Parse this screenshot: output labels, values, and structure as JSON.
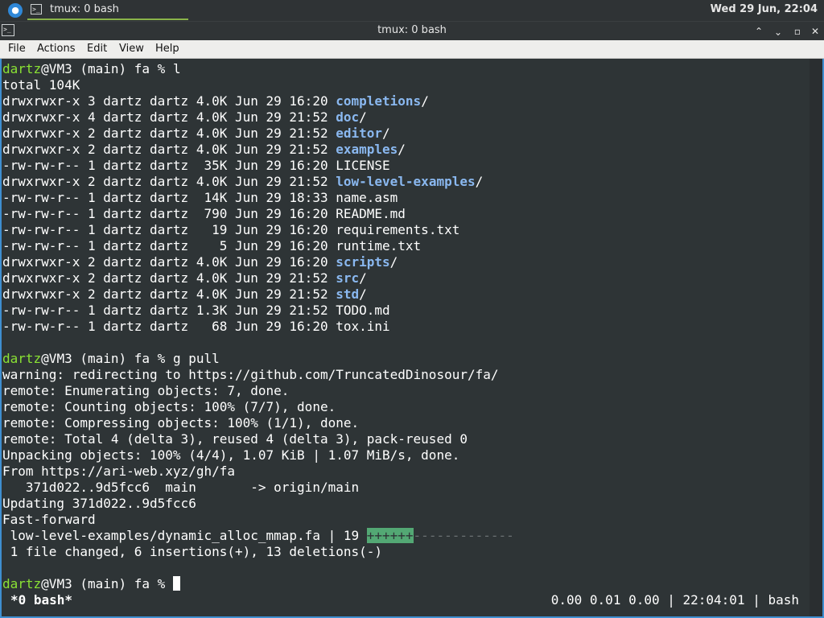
{
  "panel": {
    "task_label": "tmux: 0 bash",
    "clock": "Wed 29 Jun, 22:04"
  },
  "window": {
    "title": "tmux: 0 bash",
    "minimize": "⌃",
    "maximize": "⌃",
    "restore": "▫",
    "close": "✕"
  },
  "menu": [
    "File",
    "Actions",
    "Edit",
    "View",
    "Help"
  ],
  "prompt": {
    "user": "dartz",
    "rest": "@VM3 (main) fa % "
  },
  "commands": {
    "first": "l",
    "second": "g pull"
  },
  "ls": {
    "total": "total 104K",
    "entries": [
      {
        "prefix": "drwxrwxr-x 3 dartz dartz 4.0K Jun 29 16:20 ",
        "name": "completions",
        "dir": true
      },
      {
        "prefix": "drwxrwxr-x 4 dartz dartz 4.0K Jun 29 21:52 ",
        "name": "doc",
        "dir": true
      },
      {
        "prefix": "drwxrwxr-x 2 dartz dartz 4.0K Jun 29 21:52 ",
        "name": "editor",
        "dir": true
      },
      {
        "prefix": "drwxrwxr-x 2 dartz dartz 4.0K Jun 29 21:52 ",
        "name": "examples",
        "dir": true
      },
      {
        "prefix": "-rw-rw-r-- 1 dartz dartz  35K Jun 29 16:20 ",
        "name": "LICENSE",
        "dir": false
      },
      {
        "prefix": "drwxrwxr-x 2 dartz dartz 4.0K Jun 29 21:52 ",
        "name": "low-level-examples",
        "dir": true
      },
      {
        "prefix": "-rw-rw-r-- 1 dartz dartz  14K Jun 29 18:33 ",
        "name": "name.asm",
        "dir": false
      },
      {
        "prefix": "-rw-rw-r-- 1 dartz dartz  790 Jun 29 16:20 ",
        "name": "README.md",
        "dir": false
      },
      {
        "prefix": "-rw-rw-r-- 1 dartz dartz   19 Jun 29 16:20 ",
        "name": "requirements.txt",
        "dir": false
      },
      {
        "prefix": "-rw-rw-r-- 1 dartz dartz    5 Jun 29 16:20 ",
        "name": "runtime.txt",
        "dir": false
      },
      {
        "prefix": "drwxrwxr-x 2 dartz dartz 4.0K Jun 29 16:20 ",
        "name": "scripts",
        "dir": true
      },
      {
        "prefix": "drwxrwxr-x 2 dartz dartz 4.0K Jun 29 21:52 ",
        "name": "src",
        "dir": true
      },
      {
        "prefix": "drwxrwxr-x 2 dartz dartz 4.0K Jun 29 21:52 ",
        "name": "std",
        "dir": true
      },
      {
        "prefix": "-rw-rw-r-- 1 dartz dartz 1.3K Jun 29 21:52 ",
        "name": "TODO.md",
        "dir": false
      },
      {
        "prefix": "-rw-rw-r-- 1 dartz dartz   68 Jun 29 16:20 ",
        "name": "tox.ini",
        "dir": false
      }
    ]
  },
  "pull": {
    "lines": [
      "warning: redirecting to https://github.com/TruncatedDinosour/fa/",
      "remote: Enumerating objects: 7, done.",
      "remote: Counting objects: 100% (7/7), done.",
      "remote: Compressing objects: 100% (1/1), done.",
      "remote: Total 4 (delta 3), reused 4 (delta 3), pack-reused 0",
      "Unpacking objects: 100% (4/4), 1.07 KiB | 1.07 MiB/s, done.",
      "From https://ari-web.xyz/gh/fa",
      "   371d022..9d5fcc6  main       -> origin/main",
      "Updating 371d022..9d5fcc6",
      "Fast-forward"
    ],
    "diffstat_file": " low-level-examples/dynamic_alloc_mmap.fa | 19 ",
    "diffstat_plus": "++++++",
    "diffstat_minus": "-------------",
    "summary": " 1 file changed, 6 insertions(+), 13 deletions(-)"
  },
  "tmux": {
    "window": "*0 bash*",
    "status": "0.00 0.01 0.00 | 22:04:01 | bash"
  },
  "colors": {
    "prompt_user": "#8ae234",
    "directory": "#8ab8f0",
    "diff_plus_bg": "#53a874",
    "window_border": "#3e8ed0"
  }
}
